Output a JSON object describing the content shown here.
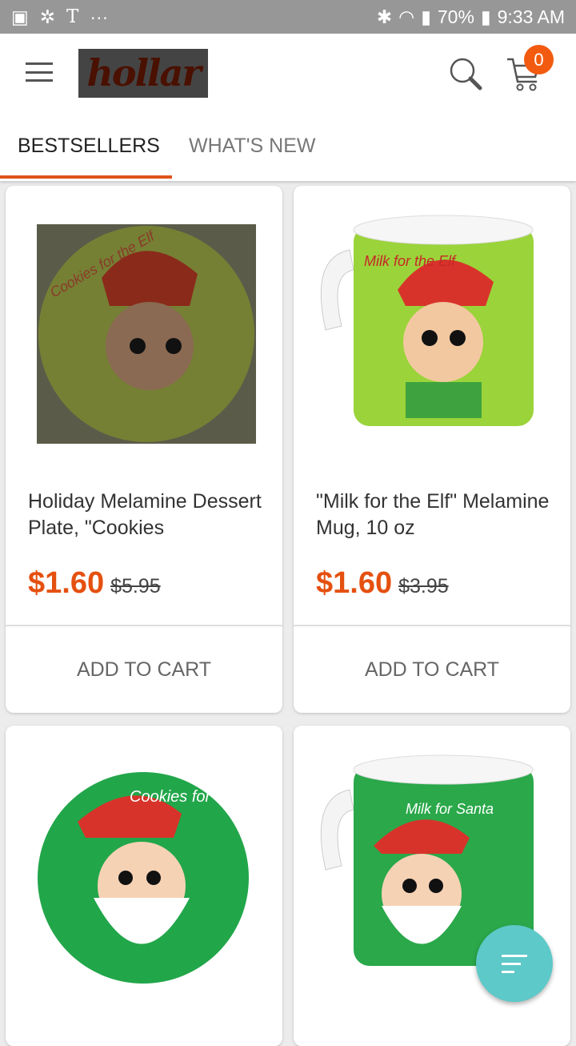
{
  "status_bar": {
    "battery": "70%",
    "time": "9:33 AM",
    "icons": [
      "image-icon",
      "cluster-icon",
      "t-icon",
      "more-icon",
      "bluetooth-icon",
      "wifi-icon",
      "signal-icon",
      "battery-icon"
    ]
  },
  "header": {
    "logo": "hollar",
    "cart_count": "0",
    "icons": [
      "menu-icon",
      "search-icon",
      "cart-icon"
    ]
  },
  "tabs": [
    {
      "label": "BESTSELLERS",
      "active": true
    },
    {
      "label": "WHAT'S NEW",
      "active": false
    }
  ],
  "colors": {
    "accent": "#e5500f",
    "fab": "#5dc9c8"
  },
  "products": [
    {
      "title": "Holiday Melamine Dessert Plate, \"Cookies",
      "price": "$1.60",
      "original_price": "$5.95",
      "button": "ADD TO CART",
      "image_text": "Cookies for the Elf"
    },
    {
      "title": "\"Milk for the Elf\" Melamine Mug, 10 oz",
      "price": "$1.60",
      "original_price": "$3.95",
      "button": "ADD TO CART",
      "image_text": "Milk for the Elf"
    },
    {
      "image_text": "Cookies for Santa"
    },
    {
      "image_text": "Milk for Santa"
    }
  ],
  "fab": {
    "icon": "filter-icon"
  }
}
